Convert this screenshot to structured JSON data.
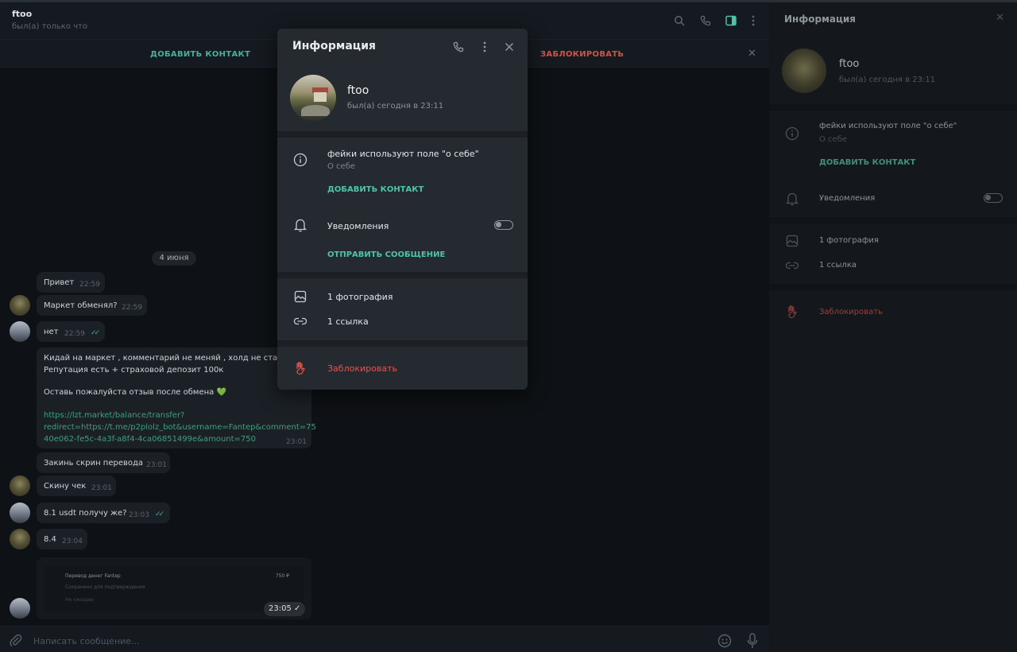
{
  "chat": {
    "name": "ftoo",
    "status": "был(а) только что",
    "action_add": "ДОБАВИТЬ КОНТАКТ",
    "action_block": "ЗАБЛОКИРОВАТЬ",
    "date_label": "4 июня",
    "messages": [
      {
        "text": "Привет",
        "time": "22:59"
      },
      {
        "text": "Маркет обменял?",
        "time": "22:59"
      },
      {
        "text": "нет",
        "time": "22:59"
      },
      {
        "time": "23:01"
      },
      {
        "text": "Закинь скрин перевода",
        "time": "23:01"
      },
      {
        "text": "Скину чек",
        "time": "23:01"
      },
      {
        "text": "8.1 usdt получу же?",
        "time": "23:03"
      },
      {
        "text": "8.4",
        "time": "23:04"
      }
    ],
    "long_message": {
      "line1": "Кидай на маркет , комментарий не меняй , холд не ставь.",
      "line2": "Репутация есть + страховой депозит 100к",
      "line3": "Оставь пожалуйста отзыв после обмена 💚",
      "link1": "https://lzt.market/balance/transfer?",
      "link2": "redirect=https://t.me/p2plolz_bot&username=Fantep&comment=75",
      "link3": "40e062-fe5c-4a3f-a8f4-4ca06851499e&amount=750"
    },
    "forward": {
      "title": "Перевод денег Fantep",
      "price": "750 ₽",
      "sub1": "Сохранено для подтверждения",
      "sub2": "Не ожидаю",
      "time": "23:05"
    },
    "composer_placeholder": "Написать сообщение..."
  },
  "panel": {
    "title": "Информация",
    "name": "ftoo",
    "status": "был(а) сегодня в 23:11",
    "about": "фейки используют поле \"о себе\"",
    "about_label": "О себе",
    "add_contact": "ДОБАВИТЬ КОНТАКТ",
    "notifications": "Уведомления",
    "photos": "1 фотография",
    "links": "1 ссылка",
    "block": "Заблокировать"
  },
  "modal": {
    "title": "Информация",
    "name": "ftoo",
    "status": "был(а) сегодня в 23:11",
    "about": "фейки используют поле \"о себе\"",
    "about_label": "О себе",
    "add_contact": "ДОБАВИТЬ КОНТАКТ",
    "notifications": "Уведомления",
    "notifications_on": false,
    "send_message": "ОТПРАВИТЬ СООБЩЕНИЕ",
    "photos": "1 фотография",
    "links": "1 ссылка",
    "block": "Заблокировать"
  },
  "colors": {
    "accent": "#4fc3a8",
    "danger": "#e5554b",
    "modal_bg": "#252a31",
    "chat_bg": "#0e1115"
  },
  "icons": [
    "search-icon",
    "phone-icon",
    "sidebar-toggle-icon",
    "more-vertical-icon",
    "close-icon",
    "info-icon",
    "bell-icon",
    "photo-icon",
    "link-icon",
    "hand-block-icon",
    "attach-icon",
    "emoji-icon",
    "mic-icon"
  ]
}
